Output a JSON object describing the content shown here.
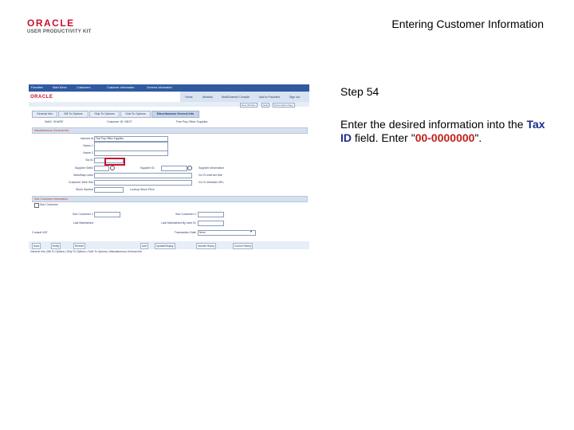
{
  "header": {
    "logo_primary": "ORACLE",
    "logo_secondary": "USER PRODUCTIVITY KIT",
    "title": "Entering Customer Information"
  },
  "step": {
    "label": "Step 54",
    "text_before": "Enter the desired information into the ",
    "field_name": "Tax ID",
    "text_middle": " field. Enter \"",
    "value": "00-0000000",
    "text_after": "\"."
  },
  "screenshot": {
    "nav": [
      "Favorites",
      "Main Menu",
      "Customers",
      "Customer Information",
      "General Information"
    ],
    "logo": "ORACLE",
    "top_links": [
      "Home",
      "Worklist",
      "MultiChannel Console",
      "Add to Favorites",
      "Sign out"
    ],
    "toolbar": [
      "New Window",
      "Help",
      "Personalize Page"
    ],
    "tabs": [
      "General Info",
      "Bill To Options",
      "Ship To Options",
      "Sold To Options",
      "Miscellaneous General Info"
    ],
    "setid": "SetID: SHARE",
    "customer_id": "Customer ID: NEXT",
    "customer_name": "Fine Pay Office Supplies",
    "misc_header": "Miscellaneous General Info",
    "form_labels": [
      "Internet Id",
      "Name 1",
      "Name 2",
      "Tax ID",
      "Supplier SetID",
      "Supplier ID",
      "Web/Map Links",
      "Customer Web Site",
      "Stock Symbol"
    ],
    "internet_id_value": "Fine Pay Office Supplies",
    "supplier_link": "Supplier Information",
    "site_link": "Go To Internet Site",
    "url_link": "Go To Website URL",
    "stock_link": "Lookup Stock Price",
    "sub_header": "Sub Customer Information",
    "sub_customer_label": "Sub Customer",
    "sub_customer_1": "Sub Customer 1",
    "sub_customer_2": "Sub Customer 2",
    "last_maintained": "Last Maintained",
    "last_by": "Last Maintained By User ID",
    "consult_vat": "Consult VAT",
    "tran_date": "Transaction Date",
    "none": "None",
    "buttons": [
      "Save",
      "Notify",
      "Refresh",
      "Add",
      "Update/Display",
      "Include History",
      "Correct History"
    ],
    "bottom_links": "General Info | Bill To Options | Ship To Options | Sold To Options | Miscellaneous General Info"
  }
}
